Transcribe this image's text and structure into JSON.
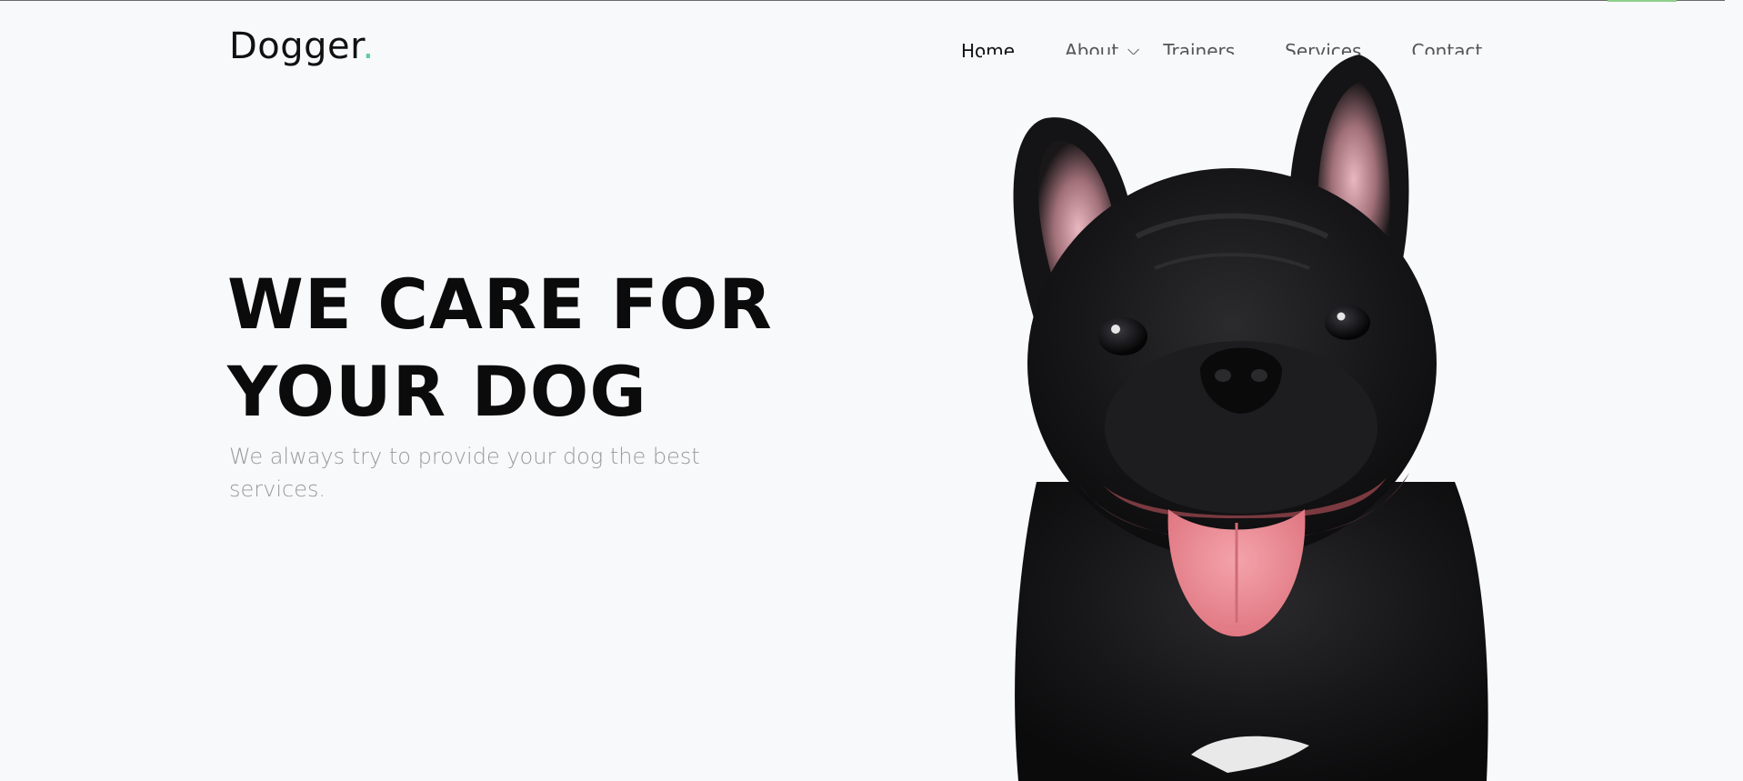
{
  "header": {
    "logo_text": "Dogger",
    "logo_dot": ".",
    "nav": [
      {
        "label": "Home",
        "active": true
      },
      {
        "label": "About",
        "has_dropdown": true
      },
      {
        "label": "Trainers"
      },
      {
        "label": "Services"
      },
      {
        "label": "Contact"
      }
    ]
  },
  "hero": {
    "title_line1": "WE CARE FOR",
    "title_line2": "YOUR DOG",
    "subtitle": "We always try to provide your dog the best services."
  },
  "colors": {
    "background": "#f8f9fb",
    "logo_dot": "#5fcf9a",
    "title": "#0b0b0b",
    "subtitle": "#9a9a9a"
  },
  "icons": {
    "about_dropdown": "chevron-down-icon",
    "hero_image": "french-bulldog-image"
  }
}
